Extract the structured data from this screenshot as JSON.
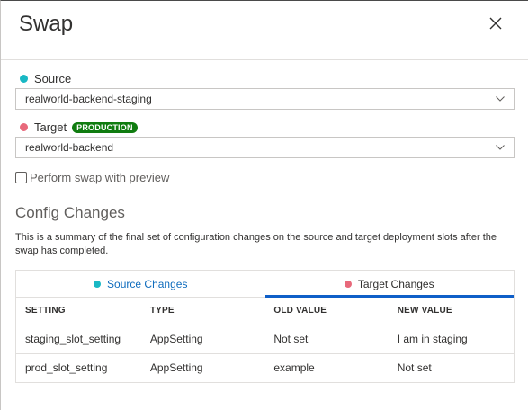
{
  "header": {
    "title": "Swap"
  },
  "source": {
    "label": "Source",
    "value": "realworld-backend-staging"
  },
  "target": {
    "label": "Target",
    "badge": "PRODUCTION",
    "value": "realworld-backend"
  },
  "preview": {
    "label": "Perform swap with preview",
    "checked": false
  },
  "config": {
    "title": "Config Changes",
    "description": "This is a summary of the final set of configuration changes on the source and target deployment slots after the swap has completed."
  },
  "tabs": [
    {
      "label": "Source Changes",
      "active": false
    },
    {
      "label": "Target Changes",
      "active": true
    }
  ],
  "table": {
    "headers": [
      "SETTING",
      "TYPE",
      "OLD VALUE",
      "NEW VALUE"
    ],
    "rows": [
      [
        "staging_slot_setting",
        "AppSetting",
        "Not set",
        "I am in staging"
      ],
      [
        "prod_slot_setting",
        "AppSetting",
        "example",
        "Not set"
      ]
    ]
  },
  "colors": {
    "source_dot": "#19b8c4",
    "target_dot": "#e8697b",
    "badge_bg": "#107c10",
    "active_tab": "#0f5fc8",
    "link": "#0f6cbd"
  }
}
